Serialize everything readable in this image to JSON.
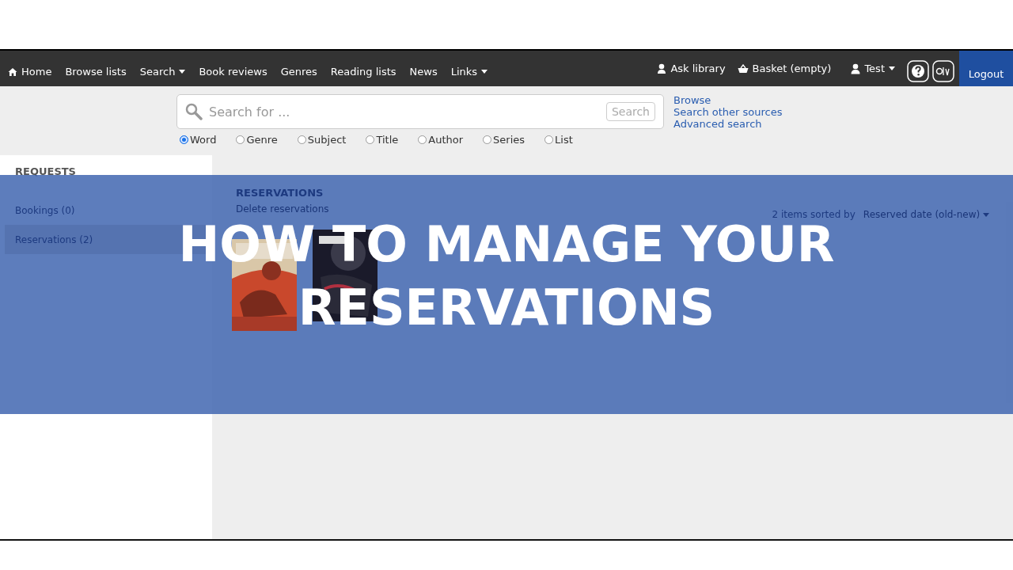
{
  "nav": {
    "items": [
      {
        "label": "Home",
        "kind": "home"
      },
      {
        "label": "Browse lists",
        "kind": "plain"
      },
      {
        "label": "Search",
        "kind": "dropdown"
      },
      {
        "label": "Book reviews",
        "kind": "plain"
      },
      {
        "label": "Genres",
        "kind": "plain"
      },
      {
        "label": "Reading lists",
        "kind": "plain"
      },
      {
        "label": "News",
        "kind": "plain"
      },
      {
        "label": "Links",
        "kind": "dropdown"
      }
    ],
    "right": [
      {
        "label": "Ask library",
        "kind": "ask"
      },
      {
        "label": "Basket (empty)",
        "kind": "basket"
      },
      {
        "label": "Test",
        "kind": "user"
      }
    ],
    "logout": "Logout"
  },
  "search": {
    "placeholder": "Search for ...",
    "button": "Search",
    "links": [
      "Browse",
      "Search other sources",
      "Advanced search"
    ],
    "options": [
      {
        "label": "Word",
        "selected": true
      },
      {
        "label": "Genre",
        "selected": false
      },
      {
        "label": "Subject",
        "selected": false
      },
      {
        "label": "Title",
        "selected": false
      },
      {
        "label": "Author",
        "selected": false
      },
      {
        "label": "Series",
        "selected": false
      },
      {
        "label": "List",
        "selected": false
      }
    ]
  },
  "sidebar": {
    "heading": "REQUESTS",
    "items": [
      {
        "label": "Bookings (0)",
        "selected": false
      },
      {
        "label": "Reservations (2)",
        "selected": true
      }
    ]
  },
  "main": {
    "heading": "RESERVATIONS",
    "action": "Delete reservations",
    "sort_summary": "2 items sorted by",
    "sort_value": "Reserved date (old-new)"
  },
  "banner": {
    "title_lines": [
      "HOW TO MANAGE YOUR",
      "RESERVATIONS"
    ]
  }
}
